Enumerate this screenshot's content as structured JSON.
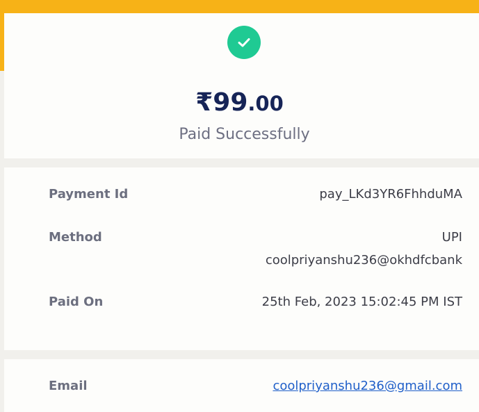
{
  "payment": {
    "currency_symbol": "₹",
    "amount_whole": "99",
    "amount_fraction": ".00",
    "status": "Paid Successfully"
  },
  "details": {
    "payment_id_label": "Payment Id",
    "payment_id_value": "pay_LKd3YR6FhhduMA",
    "method_label": "Method",
    "method_type": "UPI",
    "method_vpa": "coolpriyanshu236@okhdfcbank",
    "paid_on_label": "Paid On",
    "paid_on_value": "25th Feb, 2023 15:02:45 PM IST"
  },
  "contact": {
    "email_label": "Email",
    "email_value": "coolpriyanshu236@gmail.com"
  },
  "colors": {
    "accent": "#f7b217",
    "success": "#1fca93",
    "amount_text": "#162457",
    "link": "#1f5fc9"
  },
  "icons": {
    "status": "check-icon"
  }
}
